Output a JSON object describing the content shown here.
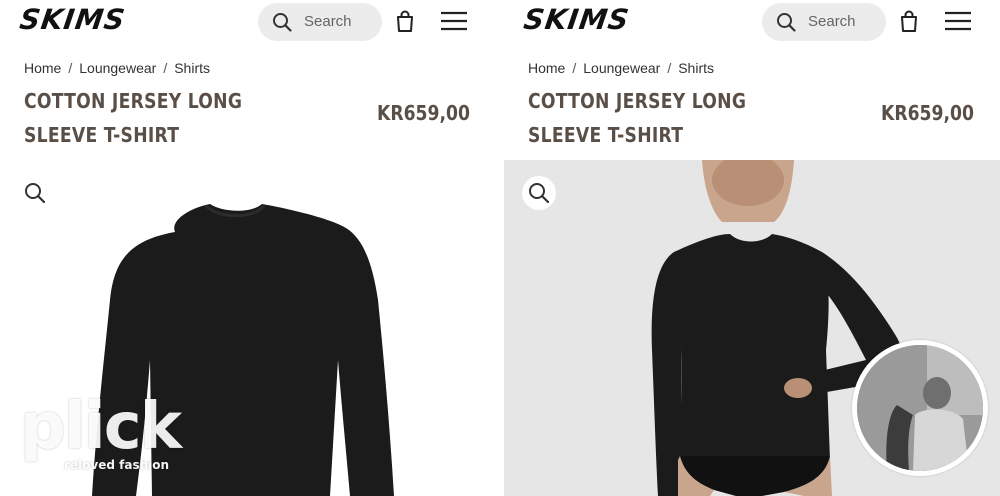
{
  "panels": [
    {
      "header": {
        "logo": "SKIMS",
        "search_placeholder": "Search"
      },
      "breadcrumb": [
        "Home",
        "Loungewear",
        "Shirts"
      ],
      "product": {
        "title": "COTTON JERSEY LONG SLEEVE T-SHIRT",
        "price": "KR659,00"
      },
      "image": {
        "background": "#ffffff",
        "subject": "flat-lay black long sleeve tee"
      }
    },
    {
      "header": {
        "logo": "SKIMS",
        "search_placeholder": "Search"
      },
      "breadcrumb": [
        "Home",
        "Loungewear",
        "Shirts"
      ],
      "product": {
        "title": "COTTON JERSEY LONG SLEEVE T-SHIRT",
        "price": "KR659,00"
      },
      "image": {
        "background": "#e6e6e6",
        "subject": "model wearing black long sleeve tee"
      }
    }
  ],
  "watermark": {
    "logo": "plick",
    "tagline": "reloved fashion"
  },
  "colors": {
    "title": "#5a4f47",
    "search_bg": "#ececec",
    "garment": "#1b1b1b"
  },
  "icons": [
    "search-icon",
    "bag-icon",
    "menu-icon",
    "zoom-icon"
  ]
}
